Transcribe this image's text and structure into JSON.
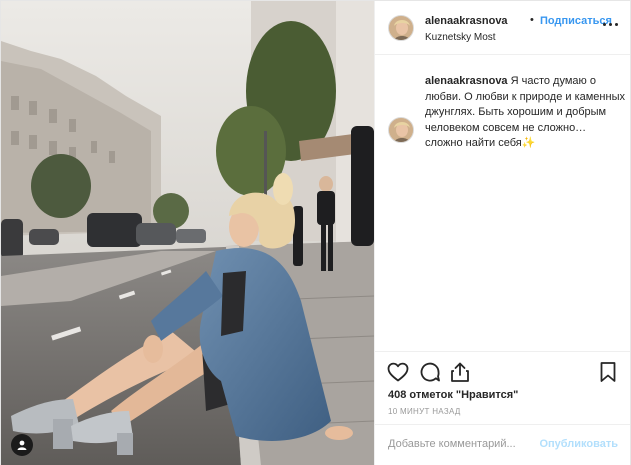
{
  "header": {
    "username": "alenaakrasnova",
    "dot": "•",
    "follow_label": "Подписаться",
    "location": "Kuznetsky Most"
  },
  "caption": {
    "username": "alenaakrasnova",
    "text": "Я часто думаю о любви. О любви к природе и каменных джунглях. Быть хорошим и добрым человеком совсем не сложно… сложно найти себя",
    "emoji": "✨"
  },
  "actions": {
    "icons": [
      "heart-icon",
      "comment-icon",
      "share-icon",
      "bookmark-icon"
    ]
  },
  "likes": "408 отметок \"Нравится\"",
  "timestamp": "10 МИНУТ НАЗАД",
  "comment": {
    "placeholder": "Добавьте комментарий...",
    "publish_label": "Опубликовать"
  },
  "colors": {
    "link_blue": "#3897f0",
    "publish_disabled": "#b2dffc",
    "text": "#262626",
    "muted": "#999999"
  }
}
